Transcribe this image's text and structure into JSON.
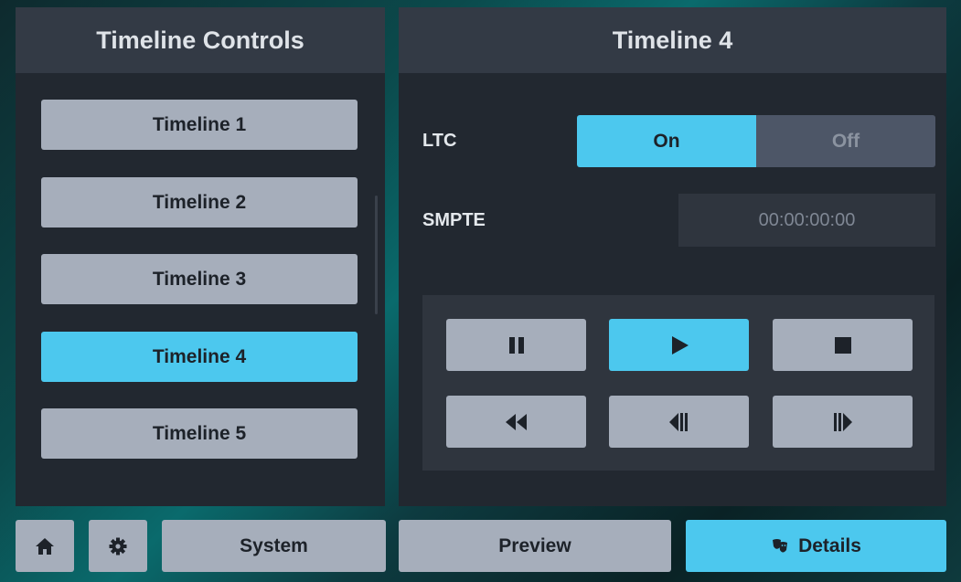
{
  "accent_color": "#4cc8ee",
  "left_panel": {
    "title": "Timeline Controls",
    "items": [
      {
        "label": "Timeline 1",
        "active": false
      },
      {
        "label": "Timeline 2",
        "active": false
      },
      {
        "label": "Timeline 3",
        "active": false
      },
      {
        "label": "Timeline 4",
        "active": true
      },
      {
        "label": "Timeline 5",
        "active": false
      }
    ]
  },
  "right_panel": {
    "title": "Timeline 4",
    "ltc": {
      "label": "LTC",
      "on_label": "On",
      "off_label": "Off",
      "selected": "On"
    },
    "smpte": {
      "label": "SMPTE",
      "value": "00:00:00:00"
    },
    "transport": {
      "buttons": [
        {
          "icon": "pause-icon",
          "active": false
        },
        {
          "icon": "play-icon",
          "active": true
        },
        {
          "icon": "stop-icon",
          "active": false
        },
        {
          "icon": "rewind-icon",
          "active": false
        },
        {
          "icon": "step-back-icon",
          "active": false
        },
        {
          "icon": "step-forward-icon",
          "active": false
        }
      ]
    }
  },
  "bottom_bar": {
    "home_icon": "home-icon",
    "settings_icon": "gear-icon",
    "system_label": "System",
    "preview_label": "Preview",
    "details_label": "Details",
    "details_icon": "theater-masks-icon",
    "active_tab": "Details"
  }
}
